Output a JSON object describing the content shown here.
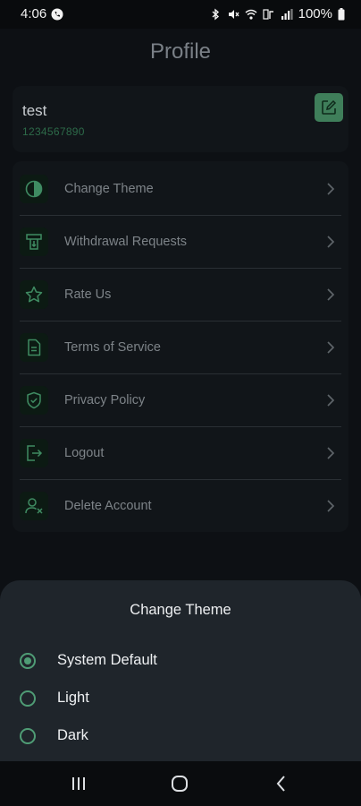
{
  "status": {
    "time": "4:06",
    "battery": "100%"
  },
  "header": {
    "title": "Profile"
  },
  "profile": {
    "name": "test",
    "phone": "1234567890"
  },
  "menu": {
    "items": [
      {
        "label": "Change Theme",
        "icon": "theme-icon"
      },
      {
        "label": "Withdrawal Requests",
        "icon": "withdrawal-icon"
      },
      {
        "label": "Rate Us",
        "icon": "star-icon"
      },
      {
        "label": "Terms of Service",
        "icon": "document-icon"
      },
      {
        "label": "Privacy Policy",
        "icon": "shield-check-icon"
      },
      {
        "label": "Logout",
        "icon": "logout-icon"
      },
      {
        "label": "Delete Account",
        "icon": "user-remove-icon"
      }
    ]
  },
  "sheet": {
    "title": "Change Theme",
    "options": [
      {
        "label": "System Default",
        "selected": true
      },
      {
        "label": "Light",
        "selected": false
      },
      {
        "label": "Dark",
        "selected": false
      }
    ]
  },
  "colors": {
    "accent": "#4f9c75",
    "background": "#0d1014",
    "card": "#111519",
    "sheet": "#1f252b"
  }
}
